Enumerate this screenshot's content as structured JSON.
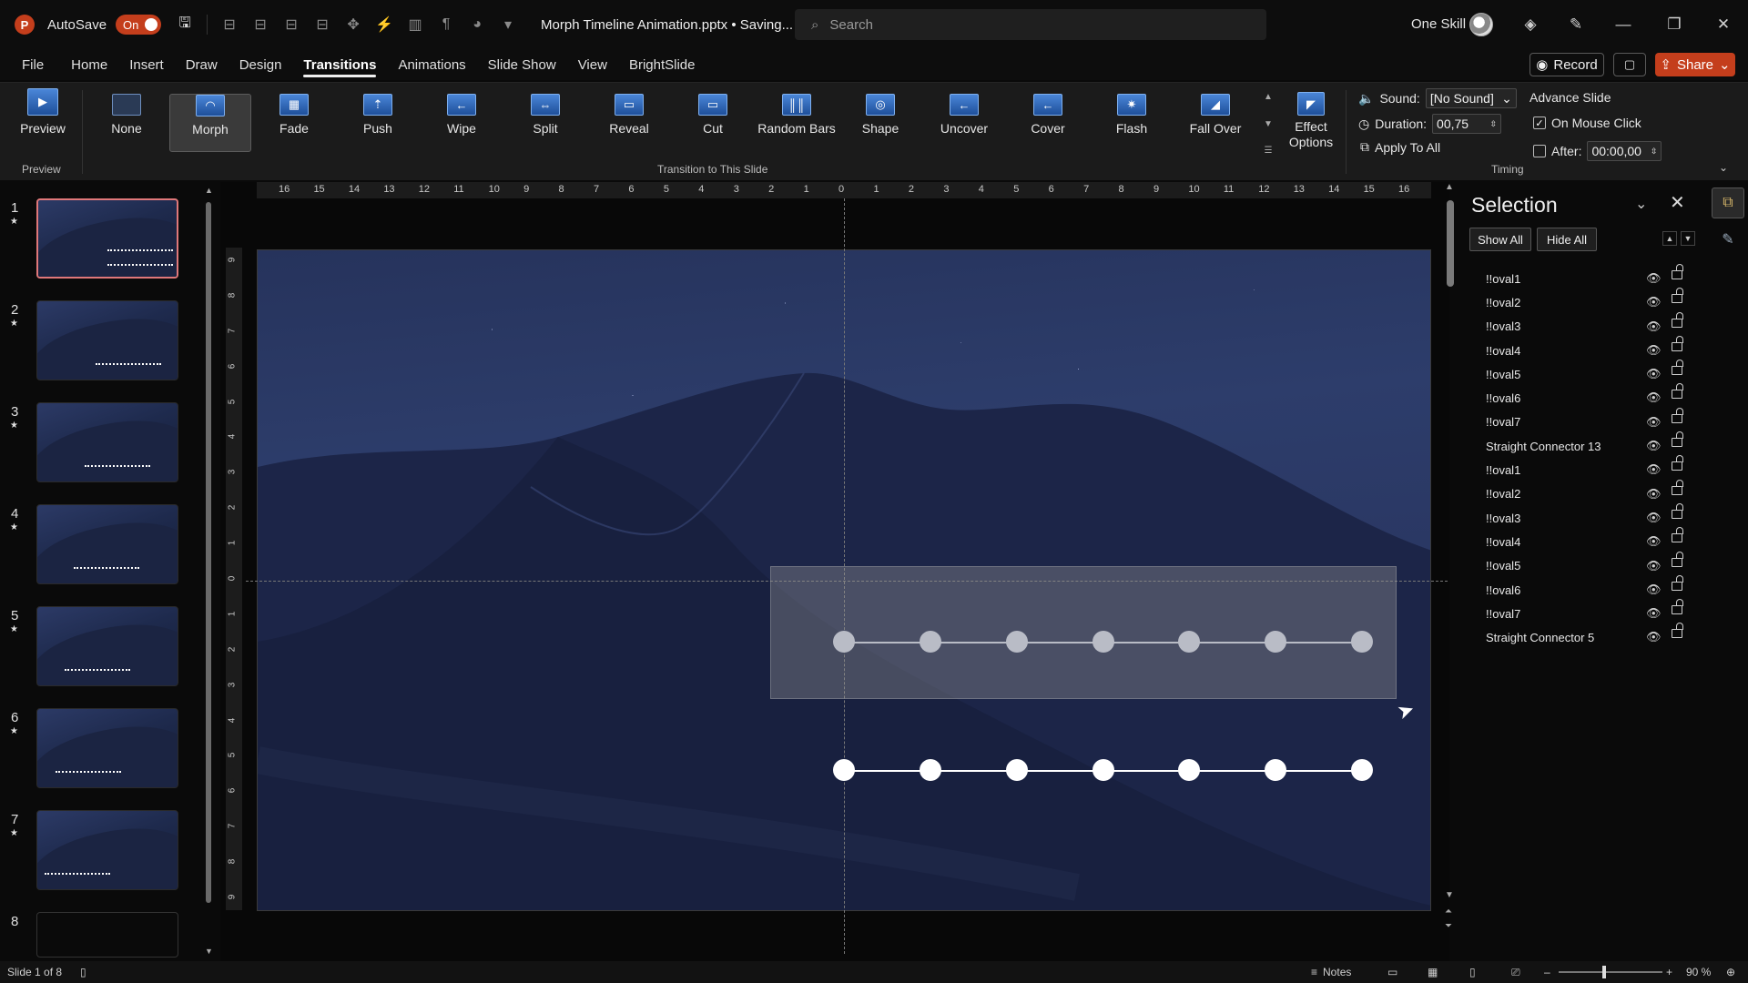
{
  "titlebar": {
    "app_logo": "P",
    "autosave_label": "AutoSave",
    "autosave_state": "On",
    "document_title": "Morph Timeline Animation.pptx • Saving...",
    "search_placeholder": "Search",
    "user_name": "One Skill"
  },
  "tabs": [
    "File",
    "Home",
    "Insert",
    "Draw",
    "Design",
    "Transitions",
    "Animations",
    "Slide Show",
    "View",
    "BrightSlide"
  ],
  "active_tab": "Transitions",
  "actions": {
    "record": "Record",
    "share": "Share"
  },
  "ribbon": {
    "preview_label": "Preview",
    "preview_group": "Preview",
    "transitions_group": "Transition to This Slide",
    "transitions": [
      "None",
      "Morph",
      "Fade",
      "Push",
      "Wipe",
      "Split",
      "Reveal",
      "Cut",
      "Random Bars",
      "Shape",
      "Uncover",
      "Cover",
      "Flash",
      "Fall Over"
    ],
    "selected_transition": "Morph",
    "effect_options": "Effect Options",
    "timing": {
      "sound_label": "Sound:",
      "sound_value": "[No Sound]",
      "duration_label": "Duration:",
      "duration_value": "00,75",
      "apply_all": "Apply To All",
      "advance_label": "Advance Slide",
      "on_mouse_click": "On Mouse Click",
      "on_mouse_click_checked": true,
      "after_label": "After:",
      "after_value": "00:00,00",
      "after_checked": false,
      "group": "Timing"
    }
  },
  "slides": [
    {
      "num": "1",
      "active": true
    },
    {
      "num": "2",
      "active": false
    },
    {
      "num": "3",
      "active": false
    },
    {
      "num": "4",
      "active": false
    },
    {
      "num": "5",
      "active": false
    },
    {
      "num": "6",
      "active": false
    },
    {
      "num": "7",
      "active": false
    },
    {
      "num": "8",
      "active": false
    }
  ],
  "ruler_h": [
    "16",
    "15",
    "14",
    "13",
    "12",
    "11",
    "10",
    "9",
    "8",
    "7",
    "6",
    "5",
    "4",
    "3",
    "2",
    "1",
    "0",
    "1",
    "2",
    "3",
    "4",
    "5",
    "6",
    "7",
    "8",
    "9",
    "10",
    "11",
    "12",
    "13",
    "14",
    "15",
    "16"
  ],
  "ruler_v": [
    "9",
    "8",
    "7",
    "6",
    "5",
    "4",
    "3",
    "2",
    "1",
    "0",
    "1",
    "2",
    "3",
    "4",
    "5",
    "6",
    "7",
    "8",
    "9"
  ],
  "slide_canvas": {
    "timeline_selected_dots": 7,
    "timeline_dots": 7,
    "colors": {
      "selected_dot": "#b9bcc6",
      "dot": "#ffffff",
      "selection_overlay": "#9a9a9a"
    }
  },
  "selection_pane": {
    "title": "Selection",
    "show_all": "Show All",
    "hide_all": "Hide All",
    "items": [
      "!!oval1",
      "!!oval2",
      "!!oval3",
      "!!oval4",
      "!!oval5",
      "!!oval6",
      "!!oval7",
      "Straight Connector 13",
      "!!oval1",
      "!!oval2",
      "!!oval3",
      "!!oval4",
      "!!oval5",
      "!!oval6",
      "!!oval7",
      "Straight Connector 5"
    ]
  },
  "statusbar": {
    "slide_info": "Slide 1 of 8",
    "notes": "Notes",
    "zoom": "90 %"
  },
  "colors": {
    "accent": "#c43e1c",
    "ribbon_bg": "#1b1b1b",
    "app_bg": "#0a0a0a"
  }
}
